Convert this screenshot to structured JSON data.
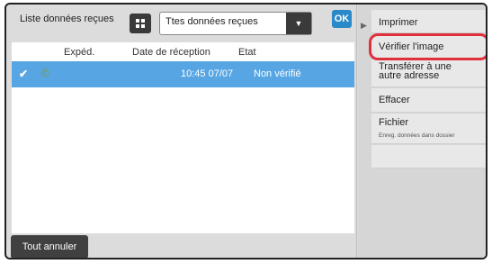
{
  "header": {
    "title": "Liste données reçues",
    "filter_value": "Ttes données reçues",
    "ok_label": "OK"
  },
  "table": {
    "columns": [
      "Expéd.",
      "Date de réception",
      "Etat"
    ],
    "rows": [
      {
        "selected": true,
        "sender_icon": "phone-icon",
        "received": "10:45 07/07",
        "status": "Non vérifié"
      }
    ]
  },
  "actions": {
    "items": [
      {
        "label": "Imprimer"
      },
      {
        "label": "Vérifier l'image",
        "highlighted": true
      },
      {
        "label": "Transférer à une autre adresse"
      },
      {
        "label": "Effacer"
      },
      {
        "label": "Fichier",
        "sub_label": "Enreg. données dans dossier"
      }
    ]
  },
  "footer": {
    "cancel_all": "Tout annuler"
  },
  "colors": {
    "selected_row": "#57a6e3",
    "ok_button": "#2a89c8",
    "highlight_ring": "#e0303c"
  }
}
